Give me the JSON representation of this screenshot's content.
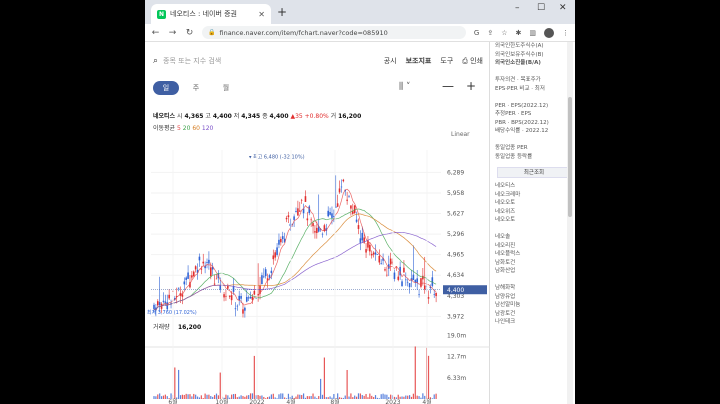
{
  "browser": {
    "tab_title": "네오티스 : 네이버 증권",
    "favicon_letter": "N",
    "url": "finance.naver.com/item/fchart.naver?code=085910"
  },
  "toolbar": {
    "search_placeholder": "종목 또는 지수 검색",
    "menu": [
      "공시",
      "보조지표",
      "도구",
      "인쇄"
    ]
  },
  "periods": [
    "일",
    "주",
    "월"
  ],
  "stock": {
    "name": "네오티스",
    "open_label": "시",
    "open": "4,365",
    "high_label": "고",
    "high": "4,400",
    "low_label": "저",
    "low": "4,345",
    "close_label": "종",
    "close": "4,400",
    "change": "▲35",
    "change_pct": "+0.80%",
    "volume_label": "거",
    "volume": "16,200"
  },
  "moving_average": {
    "label": "이동평균",
    "periods": [
      "5",
      "20",
      "60",
      "120"
    ]
  },
  "scale_mode": "Linear",
  "chart_data": {
    "type": "candlestick",
    "y_ticks": [
      "6,289",
      "5,958",
      "5,627",
      "5,296",
      "4,965",
      "4,634",
      "4,303",
      "3,972"
    ],
    "ylim": [
      3800,
      6650
    ],
    "current_price_tag": "4,400",
    "max_annotation": "최고 6,480 (-32.10%)",
    "min_annotation": "최저 3,760 (17.02%)",
    "x_ticks": [
      "6월",
      "10월",
      "2022",
      "4월",
      "8월",
      "2023",
      "4월"
    ],
    "volume_label": "거래량",
    "volume_value": "16,200",
    "volume_ticks": [
      "19.0m",
      "12.7m",
      "6.33m"
    ],
    "volume_ylim": [
      0,
      20
    ]
  },
  "side": {
    "top_lines": [
      "외국인한도주식수(A)",
      "외국인보유주식수(B)",
      "외국인소진율(B/A)",
      "",
      "투자의견 · 목표주가",
      "EPS·PER 비교 · 최저",
      "",
      "PER · EPS(2022.12)",
      "추정PER · EPS",
      "PBR · BPS(2022.12)",
      "배당수익률 · 2022.12",
      "",
      "동일업종 PER",
      "동일업종 등락률"
    ],
    "recent_tab": "최근조회",
    "recent_items": [
      "네오티스",
      "네오크레마",
      "네오오토",
      "네오위즈",
      "네오오토",
      "",
      "네오솔",
      "네오리진",
      "네오플럭스",
      "남화토건",
      "남화산업",
      "",
      "남해화학",
      "남양유업",
      "남선알미늄",
      "남광토건",
      "나인테크"
    ]
  },
  "colors": {
    "up": "#e12d2d",
    "down": "#2f63d6",
    "accent": "#3f5fa3",
    "ma5": "#e84a4a",
    "ma20": "#3fa34d",
    "ma60": "#d57b1f",
    "ma120": "#7a4fc8"
  }
}
